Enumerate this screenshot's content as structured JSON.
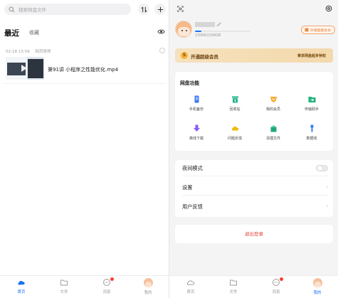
{
  "left": {
    "search": {
      "placeholder": "搜索网盘文件"
    },
    "tabs": {
      "recent": "最近",
      "favorites": "收藏"
    },
    "group": {
      "time": "02-18 13:59",
      "source": "网页修得"
    },
    "files": [
      {
        "name": "第91讲 小程序之性能优化.mp4"
      }
    ]
  },
  "right": {
    "user": {
      "storage_text": "23068/2169GB",
      "storage_fraction": 0.12
    },
    "vip_chip": "升级超级会员",
    "vip_banner": {
      "title": "开通超级会员",
      "subtitle": "尊享网盘超多特权"
    },
    "functions": {
      "title": "网盘功能",
      "items": [
        {
          "label": "手机备份",
          "icon": "phone-backup-icon",
          "color": "#3a76f0"
        },
        {
          "label": "回收站",
          "icon": "recycle-bin-icon",
          "color": "#1fb38a"
        },
        {
          "label": "我的会员",
          "icon": "vip-icon",
          "color": "#f5a623"
        },
        {
          "label": "传输助手",
          "icon": "transfer-icon",
          "color": "#21b27c"
        },
        {
          "label": "离线下载",
          "icon": "offline-download-icon",
          "color": "#8a5cf5"
        },
        {
          "label": "问题反馈",
          "icon": "feedback-icon",
          "color": "#f5b800"
        },
        {
          "label": "清理文件",
          "icon": "clean-files-icon",
          "color": "#1fa77a"
        },
        {
          "label": "数据线",
          "icon": "data-cable-icon",
          "color": "#3a7df0"
        }
      ]
    },
    "settings": {
      "night_mode": "夜间模式",
      "settings": "设置",
      "feedback": "用户反馈"
    },
    "logout": "退出登录"
  },
  "nav": {
    "home": "首页",
    "files": "文件",
    "messages": "消息",
    "mine": "我的"
  },
  "colors": {
    "accent": "#1b72f0",
    "danger": "#e9453a",
    "vip": "#e8742a"
  }
}
